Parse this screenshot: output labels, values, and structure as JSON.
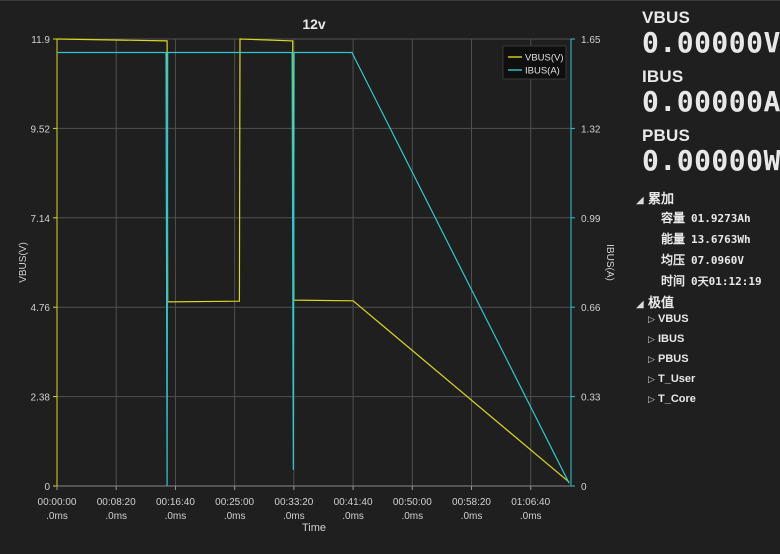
{
  "chart_data": {
    "type": "line",
    "title": "12v",
    "xlabel": "Time",
    "ylabel_left": "VBUS(V)",
    "ylabel_right": "IBUS(A)",
    "ylim_left": [
      0,
      11.9
    ],
    "ylim_right": [
      0,
      1.65
    ],
    "y_ticks_left": [
      "0",
      "2.38",
      "4.76",
      "7.14",
      "9.52",
      "11.9"
    ],
    "y_ticks_right": [
      "0",
      "0.33",
      "0.66",
      "0.99",
      "1.32",
      "1.65"
    ],
    "x_ticks": [
      {
        "t": 0,
        "top": "00:00:00",
        "bottom": ".0ms"
      },
      {
        "t": 500,
        "top": "00:08:20",
        "bottom": ".0ms"
      },
      {
        "t": 1000,
        "top": "00:16:40",
        "bottom": ".0ms"
      },
      {
        "t": 1500,
        "top": "00:25:00",
        "bottom": ".0ms"
      },
      {
        "t": 2000,
        "top": "00:33:20",
        "bottom": ".0ms"
      },
      {
        "t": 2500,
        "top": "00:41:40",
        "bottom": ".0ms"
      },
      {
        "t": 3000,
        "top": "00:50:00",
        "bottom": ".0ms"
      },
      {
        "t": 3500,
        "top": "00:58:20",
        "bottom": ".0ms"
      },
      {
        "t": 4000,
        "top": "01:06:40",
        "bottom": ".0ms"
      }
    ],
    "xlim_seconds": [
      0,
      4340
    ],
    "legend_position": "top-right",
    "grid": true,
    "series": [
      {
        "name": "VBUS(V)",
        "axis": "left",
        "color": "#d8d81e",
        "points": [
          [
            0,
            11.9
          ],
          [
            930,
            11.85
          ],
          [
            935,
            4.9
          ],
          [
            1540,
            4.92
          ],
          [
            1545,
            11.9
          ],
          [
            1990,
            11.85
          ],
          [
            2000,
            4.95
          ],
          [
            2500,
            4.93
          ],
          [
            4325,
            0.1
          ]
        ]
      },
      {
        "name": "IBUS(A)",
        "axis": "right",
        "color": "#2ec8cc",
        "points": [
          [
            0,
            1.6
          ],
          [
            920,
            1.6
          ],
          [
            930,
            0
          ],
          [
            935,
            1.6
          ],
          [
            1985,
            1.6
          ],
          [
            1995,
            0.06
          ],
          [
            2002,
            1.6
          ],
          [
            2490,
            1.6
          ],
          [
            4325,
            0.01
          ]
        ]
      }
    ]
  },
  "panel": {
    "vbus_label": "VBUS",
    "vbus_value": "0.00000V",
    "ibus_label": "IBUS",
    "ibus_value": "0.00000A",
    "pbus_label": "PBUS",
    "pbus_value": "0.00000W",
    "accum": {
      "label": "累加",
      "items": [
        {
          "k": "容量",
          "v": "01.9273Ah"
        },
        {
          "k": "能量",
          "v": "13.6763Wh"
        },
        {
          "k": "均压",
          "v": "07.0960V"
        },
        {
          "k": "时间",
          "v": "0天01:12:19"
        }
      ]
    },
    "extreme": {
      "label": "极值",
      "items": [
        "VBUS",
        "IBUS",
        "PBUS",
        "T_User",
        "T_Core"
      ]
    }
  }
}
